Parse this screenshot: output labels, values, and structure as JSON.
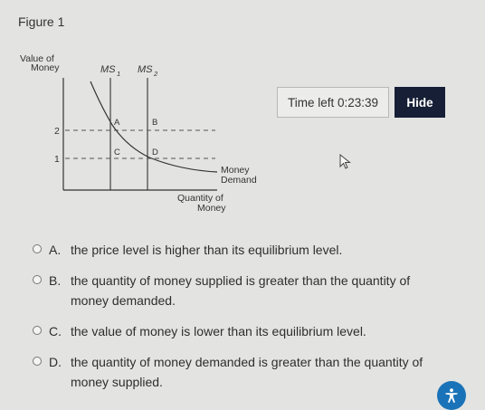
{
  "figure": {
    "title": "Figure 1",
    "y_axis_label_line1": "Value of",
    "y_axis_label_line2": "Money",
    "x_axis_label_line1": "Quantity of",
    "x_axis_label_line2": "Money",
    "ms1_label": "MS",
    "ms1_sub": "1",
    "ms2_label": "MS",
    "ms2_sub": "2",
    "demand_label_line1": "Money",
    "demand_label_line2": "Demand",
    "tick_2": "2",
    "tick_1": "1",
    "point_a": "A",
    "point_b": "B",
    "point_c": "C",
    "point_d": "D"
  },
  "timer": {
    "prefix": "Time left ",
    "value": "0:23:39"
  },
  "hide_button": {
    "label": "Hide"
  },
  "options": [
    {
      "letter": "A.",
      "text": "the price level is higher than its equilibrium level."
    },
    {
      "letter": "B.",
      "text": "the quantity of money supplied is greater than the quantity of money demanded."
    },
    {
      "letter": "C.",
      "text": "the value of money is lower than its equilibrium level."
    },
    {
      "letter": "D.",
      "text": "the quantity of money demanded is greater than the quantity of money supplied."
    }
  ],
  "accessibility_icon": "accessibility-person-icon"
}
